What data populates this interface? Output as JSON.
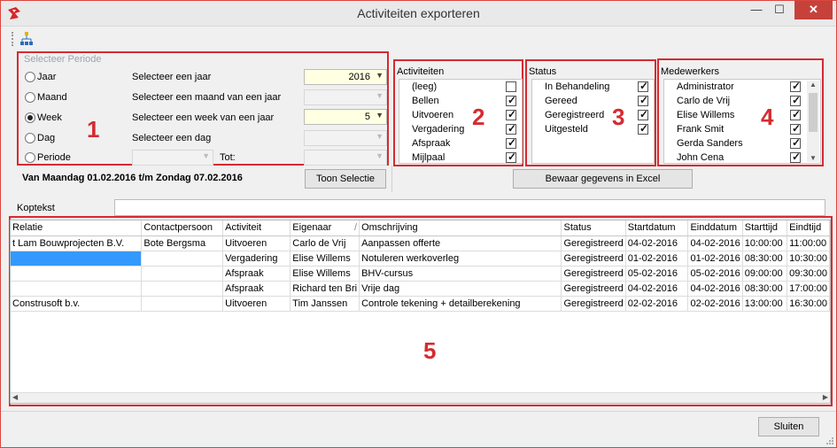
{
  "window": {
    "title": "Activiteiten exporteren",
    "min_glyph": "—",
    "max_glyph": "☐",
    "close_glyph": "✕"
  },
  "callouts": [
    "1",
    "2",
    "3",
    "4",
    "5"
  ],
  "periode": {
    "group_title": "Selecteer Periode",
    "options": [
      {
        "label": "Jaar",
        "prompt": "Selecteer een jaar",
        "value": "2016",
        "checked": false
      },
      {
        "label": "Maand",
        "prompt": "Selecteer een maand van een jaar",
        "value": "",
        "checked": false
      },
      {
        "label": "Week",
        "prompt": "Selecteer een week van een jaar",
        "value": "5",
        "checked": true
      },
      {
        "label": "Dag",
        "prompt": "Selecteer een dag",
        "value": "",
        "checked": false
      },
      {
        "label": "Periode",
        "prompt": "",
        "value": "",
        "checked": false
      }
    ],
    "tot_label": "Tot:",
    "range_text": "Van Maandag 01.02.2016 t/m Zondag 07.02.2016",
    "show_button": "Toon Selectie"
  },
  "activiteiten": {
    "title": "Activiteiten",
    "items": [
      {
        "label": "(leeg)",
        "checked": false
      },
      {
        "label": "Bellen",
        "checked": true
      },
      {
        "label": "Uitvoeren",
        "checked": true
      },
      {
        "label": "Vergadering",
        "checked": true
      },
      {
        "label": "Afspraak",
        "checked": true
      },
      {
        "label": "Mijlpaal",
        "checked": true
      }
    ]
  },
  "status": {
    "title": "Status",
    "items": [
      {
        "label": "In Behandeling",
        "checked": true
      },
      {
        "label": "Gereed",
        "checked": true
      },
      {
        "label": "Geregistreerd",
        "checked": true
      },
      {
        "label": "Uitgesteld",
        "checked": true
      }
    ]
  },
  "medewerkers": {
    "title": "Medewerkers",
    "items": [
      {
        "label": "Administrator",
        "checked": true
      },
      {
        "label": "Carlo de Vrij",
        "checked": true
      },
      {
        "label": "Elise Willems",
        "checked": true
      },
      {
        "label": "Frank Smit",
        "checked": true
      },
      {
        "label": "Gerda Sanders",
        "checked": true
      },
      {
        "label": "John Cena",
        "checked": true
      }
    ]
  },
  "export_button": "Bewaar gegevens in Excel",
  "koptekst_label": "Koptekst",
  "koptekst_value": "",
  "grid": {
    "columns": [
      "Relatie",
      "Contactpersoon",
      "Activiteit",
      "Eigenaar",
      "Omschrijving",
      "Status",
      "Startdatum",
      "Einddatum",
      "Starttijd",
      "Eindtijd"
    ],
    "sort_glyph": "/",
    "rows": [
      [
        "t Lam Bouwprojecten B.V.",
        "Bote Bergsma",
        "Uitvoeren",
        "Carlo de Vrij",
        "Aanpassen offerte",
        "Geregistreerd",
        "04-02-2016",
        "04-02-2016",
        "10:00:00",
        "11:00:00"
      ],
      [
        "",
        "",
        "Vergadering",
        "Elise Willems",
        "Notuleren werkoverleg",
        "Geregistreerd",
        "01-02-2016",
        "01-02-2016",
        "08:30:00",
        "10:30:00"
      ],
      [
        "",
        "",
        "Afspraak",
        "Elise Willems",
        "BHV-cursus",
        "Geregistreerd",
        "05-02-2016",
        "05-02-2016",
        "09:00:00",
        "09:30:00"
      ],
      [
        "",
        "",
        "Afspraak",
        "Richard ten Bri",
        "Vrije dag",
        "Geregistreerd",
        "04-02-2016",
        "04-02-2016",
        "08:30:00",
        "17:00:00"
      ],
      [
        "Construsoft b.v.",
        "",
        "Uitvoeren",
        "Tim Janssen",
        "Controle tekening + detailberekening",
        "Geregistreerd",
        "02-02-2016",
        "02-02-2016",
        "13:00:00",
        "16:30:00"
      ]
    ]
  },
  "close_button": "Sluiten",
  "colors": {
    "callout": "#d52b31",
    "selection": "#3399ff",
    "close": "#c7413b"
  }
}
